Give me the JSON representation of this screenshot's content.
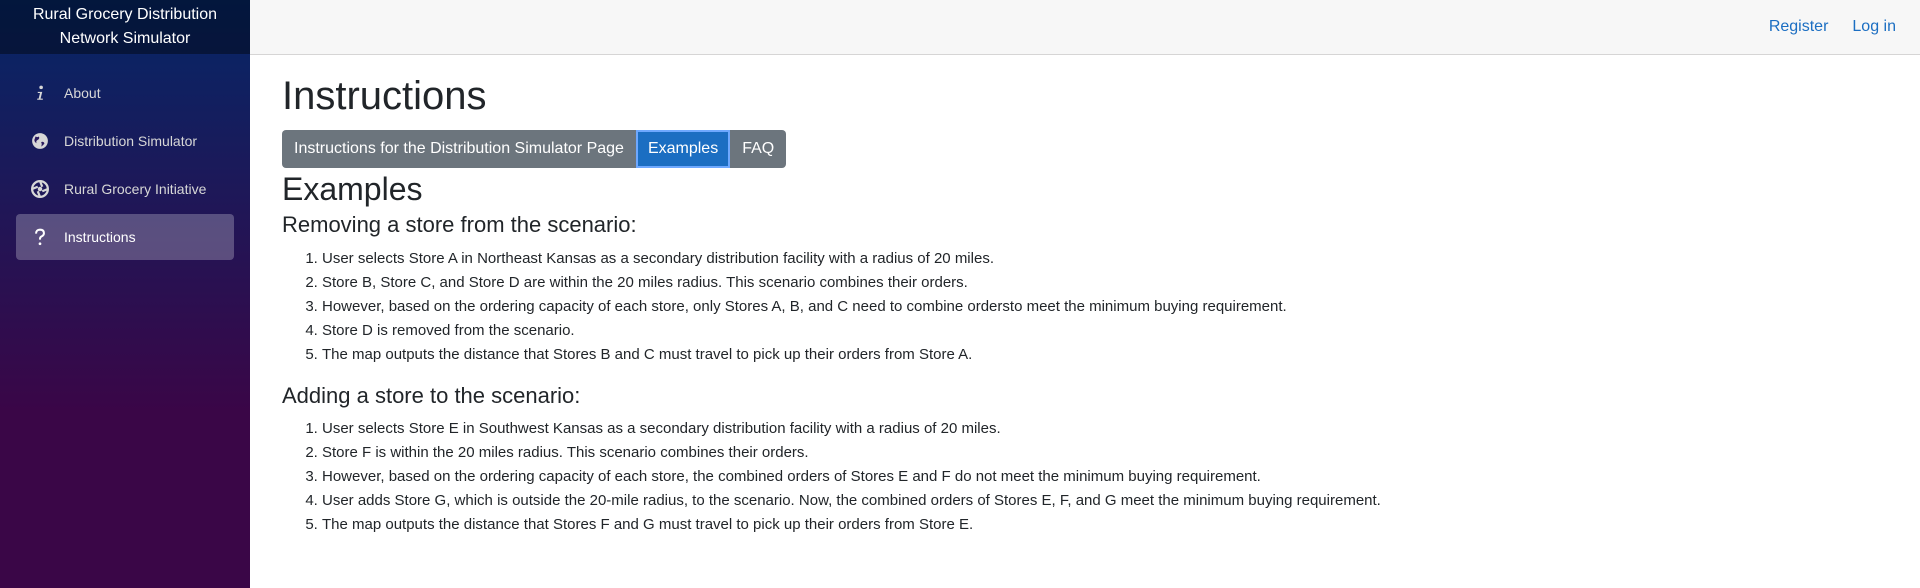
{
  "brand": {
    "line1": "Rural Grocery Distribution",
    "line2": "Network Simulator"
  },
  "sidebar": {
    "items": [
      {
        "label": "About",
        "icon": "info-icon"
      },
      {
        "label": "Distribution Simulator",
        "icon": "globe-icon"
      },
      {
        "label": "Rural Grocery Initiative",
        "icon": "aperture-icon"
      },
      {
        "label": "Instructions",
        "icon": "question-icon",
        "active": true
      }
    ]
  },
  "header": {
    "register": "Register",
    "login": "Log in"
  },
  "main": {
    "title": "Instructions",
    "tabs": [
      {
        "label": "Instructions for the Distribution Simulator Page"
      },
      {
        "label": "Examples",
        "active": true
      },
      {
        "label": "FAQ"
      }
    ],
    "section_title": "Examples",
    "examples": [
      {
        "heading": "Removing a store from the scenario:",
        "steps": [
          "User selects Store A in Northeast Kansas as a secondary distribution facility with a radius of 20 miles.",
          "Store B, Store C, and Store D are within the 20 miles radius. This scenario combines their orders.",
          "However, based on the ordering capacity of each store, only Stores A, B, and C need to combine ordersto meet the minimum buying requirement.",
          "Store D is removed from the scenario.",
          "The map outputs the distance that Stores B and C must travel to pick up their orders from Store A."
        ]
      },
      {
        "heading": "Adding a store to the scenario:",
        "steps": [
          "User selects Store E in Southwest Kansas as a secondary distribution facility with a radius of 20 miles.",
          "Store F is within the 20 miles radius. This scenario combines their orders.",
          "However, based on the ordering capacity of each store, the combined orders of Stores E and F do not meet the minimum buying requirement.",
          "User adds Store G, which is outside the 20-mile radius, to the scenario. Now, the combined orders of Stores E, F, and G meet the minimum buying requirement.",
          "The map outputs the distance that Stores F and G must travel to pick up their orders from Store E."
        ]
      }
    ]
  },
  "colors": {
    "accent": "#1b6ec2",
    "tab_bg": "#6c757d",
    "sidebar_top": "#052767",
    "sidebar_bottom": "#3a0647"
  }
}
